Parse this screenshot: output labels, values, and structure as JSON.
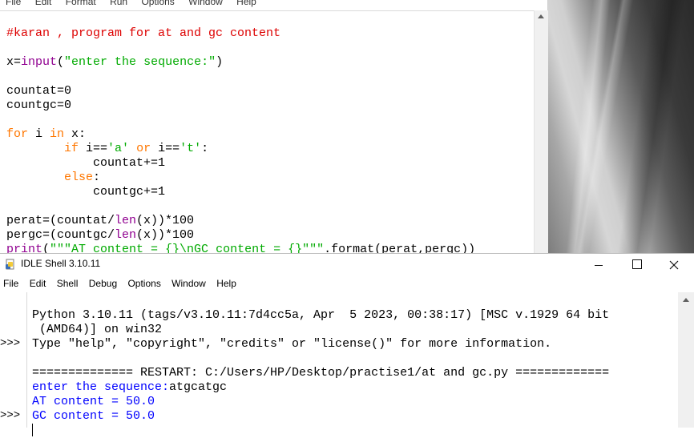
{
  "editor": {
    "menu": [
      "File",
      "Edit",
      "Format",
      "Run",
      "Options",
      "Window",
      "Help"
    ],
    "code": {
      "l1": "#karan , program for at and gc content",
      "l3_var": "x=",
      "l3_fn": "input",
      "l3_open": "(",
      "l3_str": "\"enter the sequence:\"",
      "l3_close": ")",
      "l5": "countat=0",
      "l6": "countgc=0",
      "l8_for": "for",
      "l8_mid1": " i ",
      "l8_in": "in",
      "l8_mid2": " x:",
      "l9_if": "if",
      "l9_a": " i==",
      "l9_s1": "'a'",
      "l9_or": " or",
      "l9_b": " i==",
      "l9_s2": "'t'",
      "l9_c": ":",
      "l10": "countat+=1",
      "l11_else": "else",
      "l11_c": ":",
      "l12": "countgc+=1",
      "l14_a": "perat=(countat/",
      "l14_len": "len",
      "l14_b": "(x))*100",
      "l15_a": "pergc=(countgc/",
      "l15_len": "len",
      "l15_b": "(x))*100",
      "l16_print": "print",
      "l16_open": "(",
      "l16_str": "\"\"\"AT content = {}\\nGC content = {}\"\"\"",
      "l16_rest": ".format(perat,pergc))"
    }
  },
  "shell": {
    "title": "IDLE Shell 3.10.11",
    "menu": [
      "File",
      "Edit",
      "Shell",
      "Debug",
      "Options",
      "Window",
      "Help"
    ],
    "prompts": [
      ">>>",
      ">>>"
    ],
    "banner1": "Python 3.10.11 (tags/v3.10.11:7d4cc5a, Apr  5 2023, 00:38:17) [MSC v.1929 64 bit",
    "banner2": " (AMD64)] on win32",
    "banner3": "Type \"help\", \"copyright\", \"credits\" or \"license()\" for more information.",
    "restart": "============== RESTART: C:/Users/HP/Desktop/practise1/at and gc.py =============",
    "out1_prompt": "enter the sequence:",
    "out1_input": "atgcatgc",
    "out2": "AT content = 50.0",
    "out3": "GC content = 50.0"
  }
}
